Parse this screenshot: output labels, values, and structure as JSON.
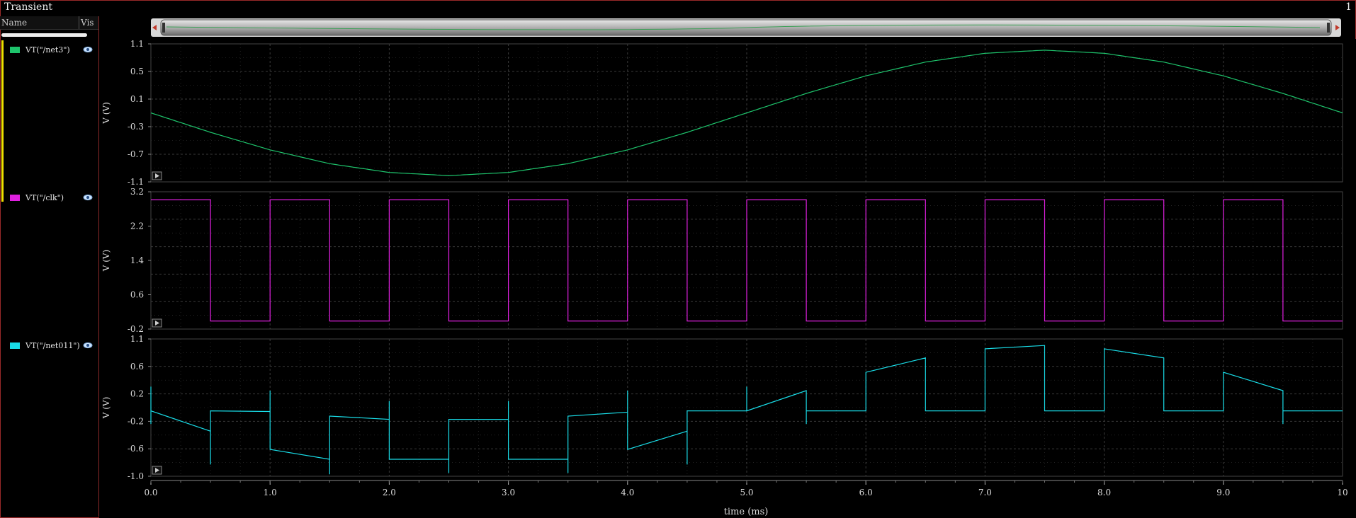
{
  "window": {
    "title": "Transient",
    "number": "1"
  },
  "sidebar": {
    "name_header": "Name",
    "vis_header": "Vis",
    "signals": [
      {
        "label": "VT(\"/net3\")",
        "color": "#1ec46c",
        "visible_icon": "eye-icon"
      },
      {
        "label": "VT(\"/clk\")",
        "color": "#e020e0",
        "visible_icon": "eye-icon"
      },
      {
        "label": "VT(\"/net011\")",
        "color": "#19dde8",
        "visible_icon": "eye-icon"
      }
    ]
  },
  "x_axis": {
    "label": "time (ms)",
    "min": 0,
    "max": 10,
    "ticks": [
      "0.0",
      "1.0",
      "2.0",
      "3.0",
      "4.0",
      "5.0",
      "6.0",
      "7.0",
      "8.0",
      "9.0",
      "10"
    ]
  },
  "chart_data": [
    {
      "type": "line",
      "series": [
        {
          "name": "VT(\"/net3\")",
          "color": "#1ec46c",
          "x": [
            0,
            0.5,
            1,
            1.5,
            2,
            2.5,
            3,
            3.5,
            4,
            4.5,
            5,
            5.5,
            6,
            6.5,
            7,
            7.5,
            8,
            8.5,
            9,
            9.5,
            10
          ],
          "y": [
            0,
            -0.31,
            -0.59,
            -0.81,
            -0.95,
            -1.0,
            -0.95,
            -0.81,
            -0.59,
            -0.31,
            0,
            0.31,
            0.59,
            0.81,
            0.95,
            1.0,
            0.95,
            0.81,
            0.59,
            0.31,
            0
          ]
        }
      ],
      "ylabel": "V (V)",
      "ylim": [
        -1.1,
        1.1
      ],
      "yticks": [
        "1.1",
        "0.5",
        "0.1",
        "-0.3",
        "-0.7",
        "-1.1"
      ]
    },
    {
      "type": "line",
      "series": [
        {
          "name": "VT(\"/clk\")",
          "color": "#e020e0",
          "x": [
            0,
            0.5,
            0.5,
            1,
            1,
            1.5,
            1.5,
            2,
            2,
            2.5,
            2.5,
            3,
            3,
            3.5,
            3.5,
            4,
            4,
            4.5,
            4.5,
            5,
            5,
            5.5,
            5.5,
            6,
            6,
            6.5,
            6.5,
            7,
            7,
            7.5,
            7.5,
            8,
            8,
            8.5,
            8.5,
            9,
            9,
            9.5,
            9.5,
            10
          ],
          "y": [
            3,
            3,
            0,
            0,
            3,
            3,
            0,
            0,
            3,
            3,
            0,
            0,
            3,
            3,
            0,
            0,
            3,
            3,
            0,
            0,
            3,
            3,
            0,
            0,
            3,
            3,
            0,
            0,
            3,
            3,
            0,
            0,
            3,
            3,
            0,
            0,
            3,
            3,
            0,
            0
          ]
        }
      ],
      "ylabel": "V (V)",
      "ylim": [
        -0.2,
        3.2
      ],
      "yticks": [
        "3.2",
        "2.2",
        "1.4",
        "0.6",
        "-0.2"
      ]
    },
    {
      "type": "line",
      "series": [
        {
          "name": "VT(\"/net011\")",
          "color": "#19dde8",
          "x": [
            0,
            0,
            0,
            0.5,
            0.5,
            0.5,
            0.5,
            1,
            1,
            1,
            1,
            1.5,
            1.5,
            1.5,
            1.5,
            2,
            2,
            2,
            2,
            2.5,
            2.5,
            2.5,
            2.5,
            3,
            3,
            3,
            3,
            3.5,
            3.5,
            3.5,
            3.5,
            4,
            4,
            4,
            4,
            4.5,
            4.5,
            4.5,
            4.5,
            5,
            5,
            5,
            5,
            5.5,
            5.5,
            5.5,
            5.5,
            6,
            6,
            6.5,
            6.5,
            7,
            7,
            7.5,
            7.5,
            8,
            8,
            8.5,
            8.5,
            9,
            9,
            9.5,
            9.5,
            9.5,
            9.5,
            10
          ],
          "y": [
            0.37,
            -0.2,
            0,
            -0.31,
            -0.82,
            0,
            0,
            -0.01,
            0.31,
            -0.01,
            -0.59,
            -0.74,
            -0.97,
            -0.08,
            -0.08,
            -0.13,
            0.15,
            -0.13,
            -0.74,
            -0.74,
            -0.95,
            -0.13,
            -0.13,
            -0.13,
            0.15,
            -0.13,
            -0.74,
            -0.74,
            -0.95,
            -0.08,
            -0.08,
            -0.02,
            0.31,
            -0.02,
            -0.59,
            -0.31,
            -0.82,
            -0.31,
            0,
            0,
            0.37,
            0,
            0,
            0.31,
            -0.2,
            0,
            0,
            0,
            0.59,
            0.81,
            0,
            0,
            0.95,
            1.0,
            0,
            0,
            0.95,
            0.81,
            0,
            0,
            0.59,
            0.31,
            -0.2,
            0.31,
            0,
            0
          ]
        }
      ],
      "ylabel": "V (V)",
      "ylim": [
        -1.0,
        1.1
      ],
      "yticks": [
        "1.1",
        "0.6",
        "0.2",
        "-0.2",
        "-0.6",
        "-1.0"
      ]
    }
  ]
}
